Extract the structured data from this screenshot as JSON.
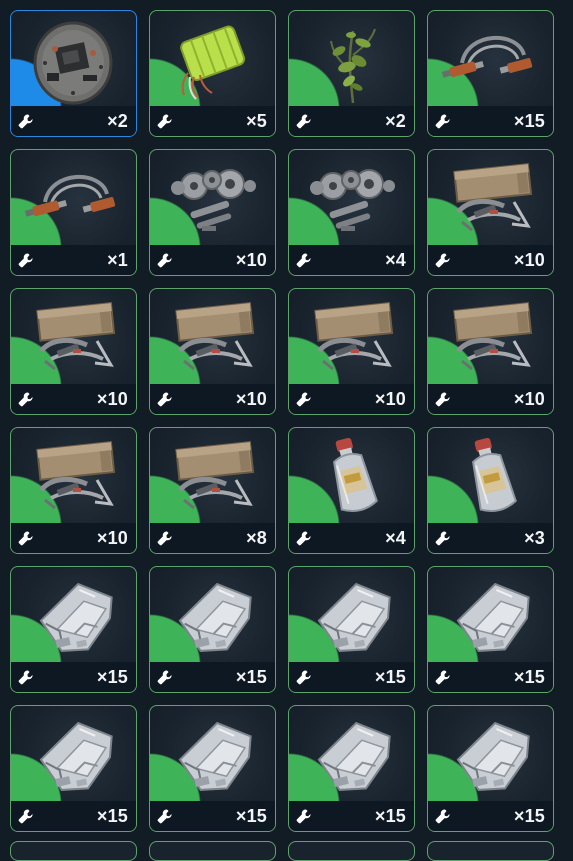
{
  "inventory": {
    "slots": [
      {
        "item": "circuit-board-icon",
        "qty": "×2",
        "rarity": "blue"
      },
      {
        "item": "battery-pack-icon",
        "qty": "×5",
        "rarity": "green"
      },
      {
        "item": "plant-icon",
        "qty": "×2",
        "rarity": "green"
      },
      {
        "item": "cable-connector-icon",
        "qty": "×15",
        "rarity": "green"
      },
      {
        "item": "cable-connector-icon",
        "qty": "×1",
        "rarity": "green"
      },
      {
        "item": "mechanical-parts-icon",
        "qty": "×10",
        "rarity": "green"
      },
      {
        "item": "mechanical-parts-icon",
        "qty": "×4",
        "rarity": "green"
      },
      {
        "item": "tool-kit-icon",
        "qty": "×10",
        "rarity": "green"
      },
      {
        "item": "tool-kit-icon",
        "qty": "×10",
        "rarity": "green"
      },
      {
        "item": "tool-kit-icon",
        "qty": "×10",
        "rarity": "green"
      },
      {
        "item": "tool-kit-icon",
        "qty": "×10",
        "rarity": "green"
      },
      {
        "item": "tool-kit-icon",
        "qty": "×10",
        "rarity": "green"
      },
      {
        "item": "tool-kit-icon",
        "qty": "×10",
        "rarity": "green"
      },
      {
        "item": "tool-kit-icon",
        "qty": "×8",
        "rarity": "green"
      },
      {
        "item": "bottle-icon",
        "qty": "×4",
        "rarity": "green"
      },
      {
        "item": "bottle-icon",
        "qty": "×3",
        "rarity": "green"
      },
      {
        "item": "metal-plating-icon",
        "qty": "×15",
        "rarity": "green"
      },
      {
        "item": "metal-plating-icon",
        "qty": "×15",
        "rarity": "green"
      },
      {
        "item": "metal-plating-icon",
        "qty": "×15",
        "rarity": "green"
      },
      {
        "item": "metal-plating-icon",
        "qty": "×15",
        "rarity": "green"
      },
      {
        "item": "metal-plating-icon",
        "qty": "×15",
        "rarity": "green"
      },
      {
        "item": "metal-plating-icon",
        "qty": "×15",
        "rarity": "green"
      },
      {
        "item": "metal-plating-icon",
        "qty": "×15",
        "rarity": "green"
      },
      {
        "item": "metal-plating-icon",
        "qty": "×15",
        "rarity": "green"
      }
    ],
    "action_icon": "wrench-icon",
    "colors": {
      "green": "#3fb358",
      "blue": "#1f8be8",
      "background": "#121c24"
    }
  }
}
